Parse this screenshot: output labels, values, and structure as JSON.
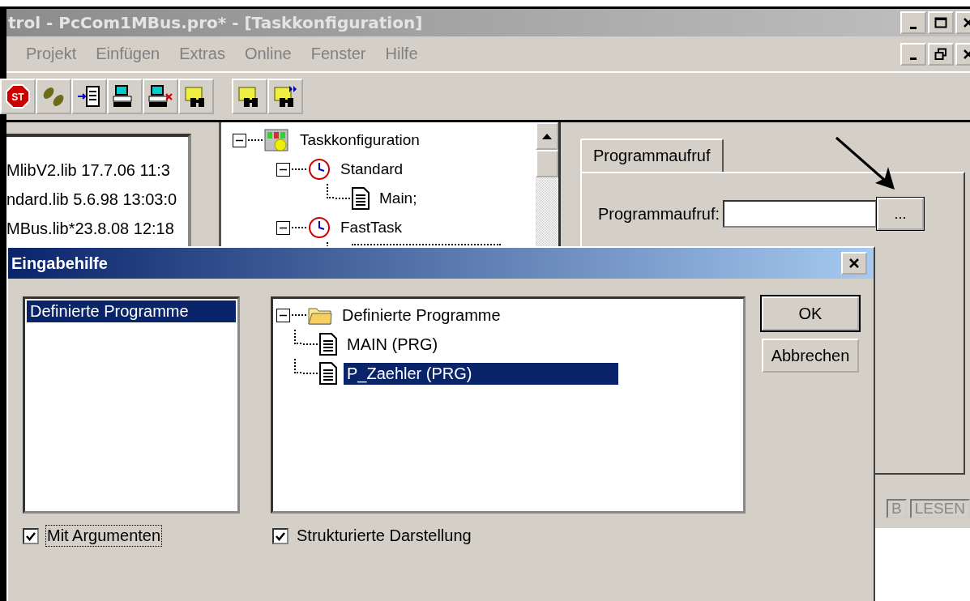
{
  "window": {
    "title": "trol - PcCom1MBus.pro* - [Taskkonfiguration]"
  },
  "menu": [
    "Projekt",
    "Einfügen",
    "Extras",
    "Online",
    "Fenster",
    "Hilfe"
  ],
  "toolbar": [
    [
      {
        "kind": "stop",
        "label": "ST"
      },
      {
        "kind": "footsteps"
      },
      {
        "kind": "arrow-list"
      },
      {
        "kind": "computer"
      },
      {
        "kind": "computer-x"
      },
      {
        "kind": "folder-binoculars"
      }
    ],
    [
      {
        "kind": "folder-binoculars"
      },
      {
        "kind": "folder-binoculars-forward"
      }
    ]
  ],
  "libraries": [
    "MlibV2.lib 17.7.06 11:3",
    "ndard.lib 5.6.98 13:03:0",
    "MBus.lib*23.8.08 12:18"
  ],
  "task_tree": [
    {
      "label": "Taskkonfiguration",
      "kind": "config",
      "expanded": true,
      "children": [
        {
          "label": "Standard",
          "kind": "task",
          "expanded": true,
          "children": [
            {
              "label": "Main;",
              "kind": "program"
            }
          ]
        },
        {
          "label": "FastTask",
          "kind": "task",
          "expanded": true,
          "children": [
            {
              "kind": "edit"
            }
          ]
        }
      ]
    }
  ],
  "properties": {
    "tabs": [
      {
        "label": "Programmaufruf",
        "selected": true
      }
    ],
    "field_label": "Programmaufruf:",
    "browse_button": "..."
  },
  "status_bar": [
    "B",
    "LESEN"
  ],
  "dialog": {
    "title": "Eingabehilfe",
    "categories": [
      {
        "label": "Definierte Programme",
        "selected": true
      }
    ],
    "tree": [
      {
        "label": "Definierte Programme",
        "kind": "folder",
        "expanded": true,
        "selected": false,
        "children": [
          {
            "label": "MAIN (PRG)",
            "kind": "program",
            "selected": false
          },
          {
            "label": "P_Zaehler (PRG)",
            "kind": "program",
            "selected": true
          }
        ]
      }
    ],
    "buttons": [
      "OK",
      "Abbrechen"
    ],
    "options": [
      {
        "label": "Mit Argumenten",
        "checked": true,
        "focused": true
      },
      {
        "label": "Strukturierte Darstellung",
        "checked": true,
        "focused": false
      }
    ]
  }
}
